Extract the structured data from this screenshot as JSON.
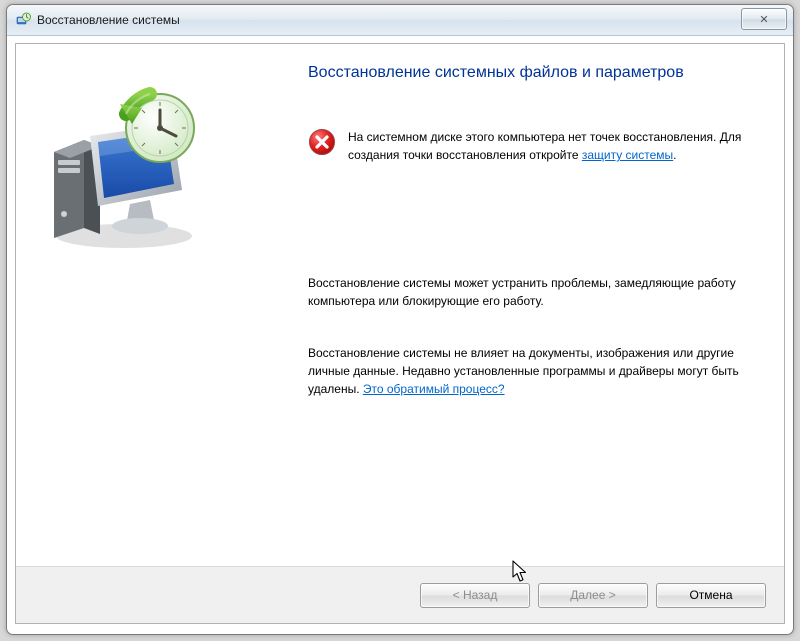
{
  "window": {
    "title": "Восстановление системы"
  },
  "heading": "Восстановление системных файлов и параметров",
  "error": {
    "text_before_link": "На системном диске этого компьютера нет точек восстановления. Для создания точки восстановления откройте ",
    "link": "защиту системы",
    "text_after_link": "."
  },
  "para1": "Восстановление системы может устранить проблемы, замедляющие работу компьютера или блокирующие его работу.",
  "para2_before_link": "Восстановление системы не влияет на документы, изображения или другие личные данные. Недавно установленные программы и драйверы могут быть удалены. ",
  "para2_link": "Это обратимый процесс?",
  "buttons": {
    "back": "< Назад",
    "next": "Далее >",
    "cancel": "Отмена"
  },
  "close_glyph": "✕"
}
